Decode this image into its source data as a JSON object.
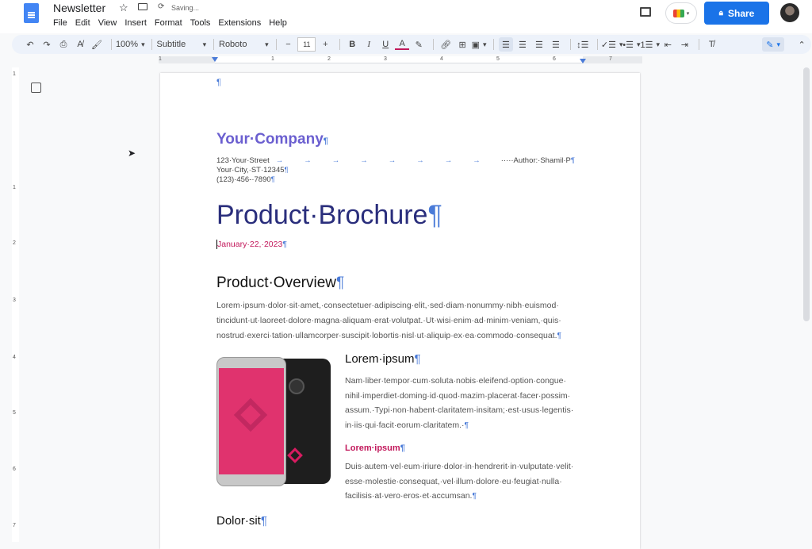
{
  "header": {
    "title": "Newsletter",
    "status": "Saving...",
    "menu": [
      "File",
      "Edit",
      "View",
      "Insert",
      "Format",
      "Tools",
      "Extensions",
      "Help"
    ],
    "share_label": "Share"
  },
  "toolbar": {
    "zoom": "100%",
    "style": "Subtitle",
    "font": "Roboto",
    "font_size": "11"
  },
  "ruler": {
    "h": [
      "1",
      "1",
      "2",
      "3",
      "4",
      "5",
      "6",
      "7"
    ],
    "v": [
      "1",
      "1",
      "2",
      "3",
      "4",
      "5",
      "6",
      "7"
    ]
  },
  "doc": {
    "pilcrow": "¶",
    "company": "Your·Company",
    "street": "123·Your·Street",
    "author": "·····Author:·Shamil·P",
    "city": "Your·City,·ST·12345",
    "phone": "(123)·456-·7890",
    "title": "Product·Brochure",
    "date": "January·22,·2023",
    "h_overview": "Product·Overview",
    "overview_lines": [
      "Lorem·ipsum·dolor·sit·amet,·consectetuer·adipiscing·elit,·sed·diam·nonummy·nibh·euismod·",
      "tincidunt·ut·laoreet·dolore·magna·aliquam·erat·volutpat.·Ut·wisi·enim·ad·minim·veniam,·quis·",
      "nostrud·exerci·tation·ullamcorper·suscipit·lobortis·nisl·ut·aliquip·ex·ea·commodo·consequat."
    ],
    "h_lorem": "Lorem·ipsum",
    "lorem_lines": [
      "Nam·liber·tempor·cum·soluta·nobis·eleifend·option·congue·",
      "nihil·imperdiet·doming·id·quod·mazim·placerat·facer·possim·",
      "assum.·Typi·non·habent·claritatem·insitam;·est·usus·legentis·",
      "in·iis·qui·facit·eorum·claritatem.·"
    ],
    "sub_lorem": "Lorem·ipsum",
    "duis_lines": [
      "Duis·autem·vel·eum·iriure·dolor·in·hendrerit·in·vulputate·velit·",
      "esse·molestie·consequat,·vel·illum·dolore·eu·feugiat·nulla·",
      "facilisis·at·vero·eros·et·accumsan."
    ],
    "h_dolor": "Dolor·sit"
  },
  "colors": {
    "company": "#6b5fd0",
    "title": "#2a2e7c",
    "date": "#c2185b",
    "accent": "#1a73e8"
  }
}
